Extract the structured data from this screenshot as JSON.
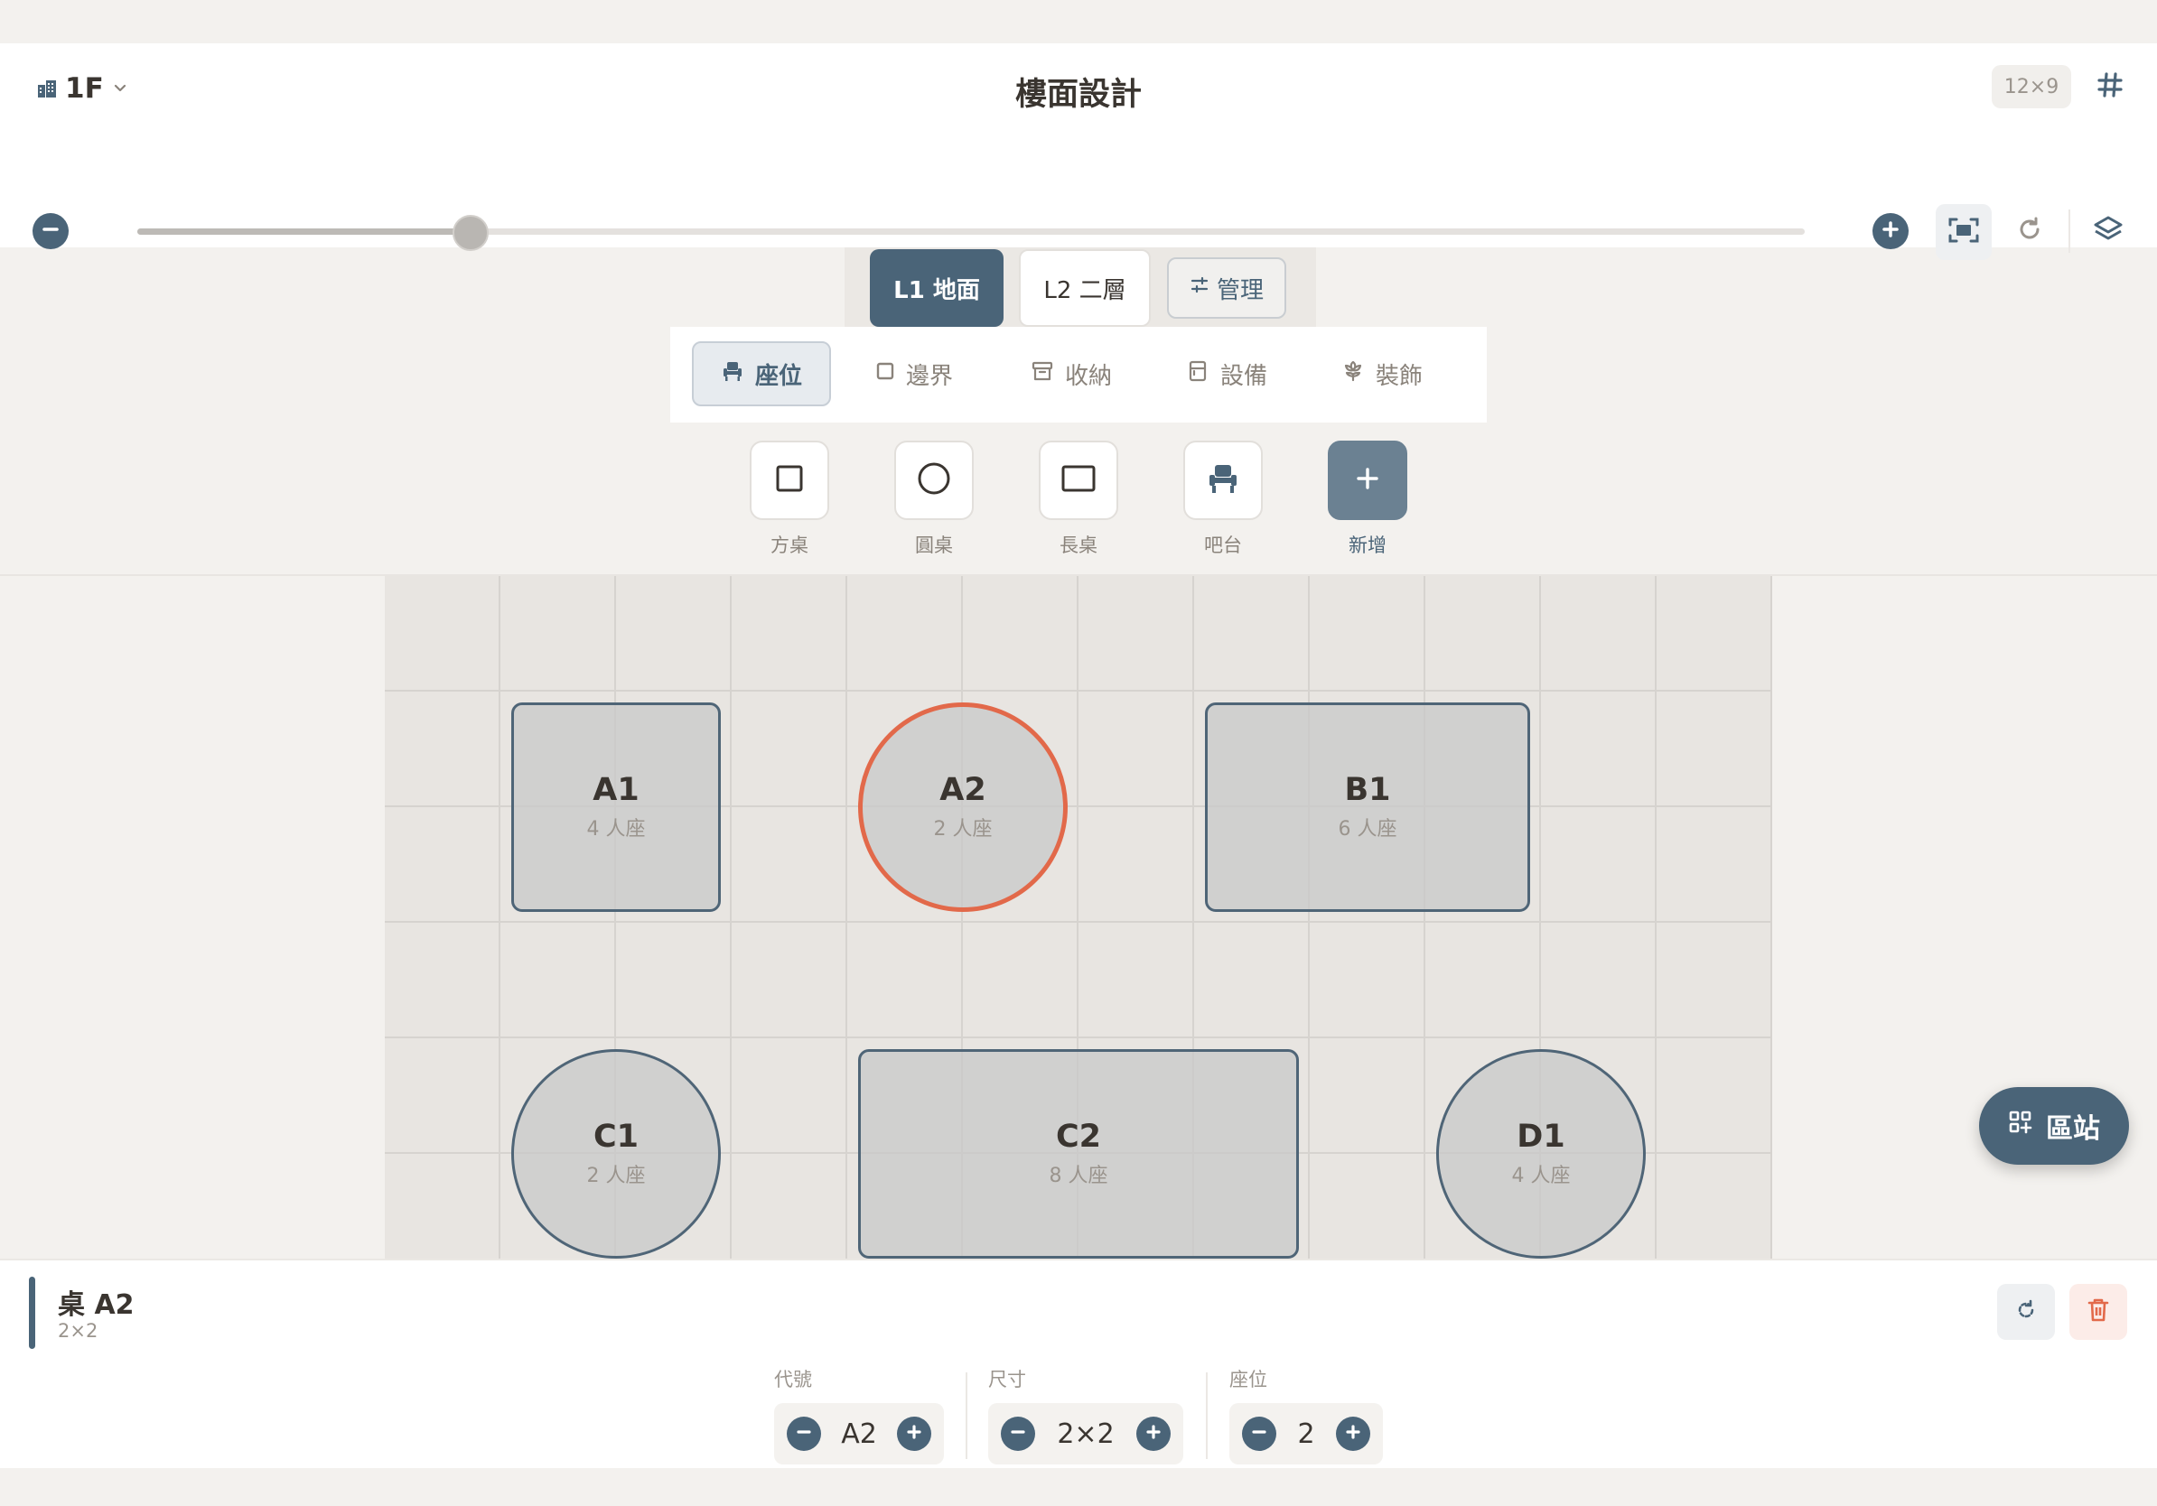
{
  "header": {
    "floor": "1F",
    "title": "樓面設計",
    "grid_size": "12×9",
    "zoom_level": 0.2
  },
  "levels": [
    {
      "label": "L1 地面",
      "active": true
    },
    {
      "label": "L2 二層",
      "active": false
    }
  ],
  "manage_label": "管理",
  "categories": [
    {
      "label": "座位",
      "icon": "armchair-icon",
      "active": true
    },
    {
      "label": "邊界",
      "icon": "square-outline-icon",
      "active": false
    },
    {
      "label": "收納",
      "icon": "archive-box-icon",
      "active": false
    },
    {
      "label": "設備",
      "icon": "appliance-icon",
      "active": false
    },
    {
      "label": "裝飾",
      "icon": "flower-icon",
      "active": false
    }
  ],
  "tools": [
    {
      "label": "方桌",
      "icon": "square-table-icon"
    },
    {
      "label": "圓桌",
      "icon": "round-table-icon"
    },
    {
      "label": "長桌",
      "icon": "long-table-icon"
    },
    {
      "label": "吧台",
      "icon": "bar-chair-icon"
    },
    {
      "label": "新增",
      "icon": "plus-icon"
    }
  ],
  "tables": [
    {
      "code": "A1",
      "seats": "4 人座",
      "shape": "rect"
    },
    {
      "code": "A2",
      "seats": "2 人座",
      "shape": "round",
      "selected": true
    },
    {
      "code": "B1",
      "seats": "6 人座",
      "shape": "rect"
    },
    {
      "code": "C1",
      "seats": "2 人座",
      "shape": "round"
    },
    {
      "code": "C2",
      "seats": "8 人座",
      "shape": "rect"
    },
    {
      "code": "D1",
      "seats": "4 人座",
      "shape": "round"
    }
  ],
  "fab_label": "區站",
  "selected": {
    "title": "桌 A2",
    "size": "2×2",
    "fields": [
      {
        "label": "代號",
        "value": "A2"
      },
      {
        "label": "尺寸",
        "value": "2×2"
      },
      {
        "label": "座位",
        "value": "2"
      }
    ]
  },
  "colors": {
    "primary": "#4a6478",
    "selected_outline": "#e2694a",
    "delete": "#e2694a"
  }
}
